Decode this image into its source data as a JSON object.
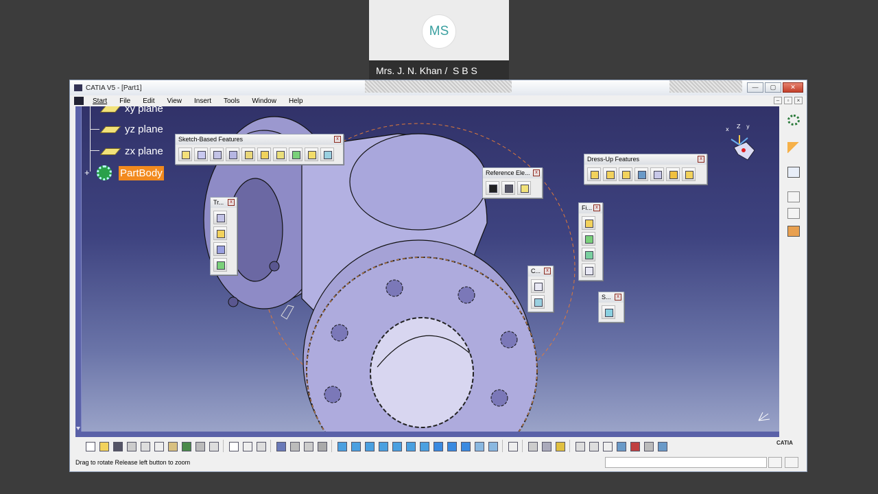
{
  "presenter": {
    "initials": "MS",
    "name": "Mrs. J. N. Khan /  S B S"
  },
  "window": {
    "title": "CATIA V5 - [Part1]",
    "controls": {
      "minimize": "—",
      "maximize": "▢",
      "close": "✕"
    },
    "mdi_controls": {
      "minimize": "–",
      "restore": "▫",
      "close": "×"
    }
  },
  "menu": {
    "items": [
      "Start",
      "File",
      "Edit",
      "View",
      "Insert",
      "Tools",
      "Window",
      "Help"
    ]
  },
  "tree": {
    "items": [
      {
        "label": "xy plane"
      },
      {
        "label": "yz plane"
      },
      {
        "label": "zx plane"
      }
    ],
    "partbody": "PartBody"
  },
  "toolbars": {
    "sketch_based": {
      "title": "Sketch-Based Features",
      "close": "x"
    },
    "reference": {
      "title": "Reference Ele...",
      "close": "x"
    },
    "dress_up": {
      "title": "Dress-Up Features",
      "close": "x"
    },
    "transform": {
      "title": "Tr...",
      "close": "x"
    },
    "fillet": {
      "title": "Fi...",
      "close": "x"
    },
    "constraint": {
      "title": "C...",
      "close": "x"
    },
    "surface": {
      "title": "S...",
      "close": "x"
    }
  },
  "viewport": {
    "axis_label": "Z",
    "axis_label_x": "x",
    "axis_label_y": "y"
  },
  "bottom": {
    "logo": "CATIA"
  },
  "status": {
    "text": "Drag to rotate  Release left button to zoom",
    "input_value": ""
  }
}
